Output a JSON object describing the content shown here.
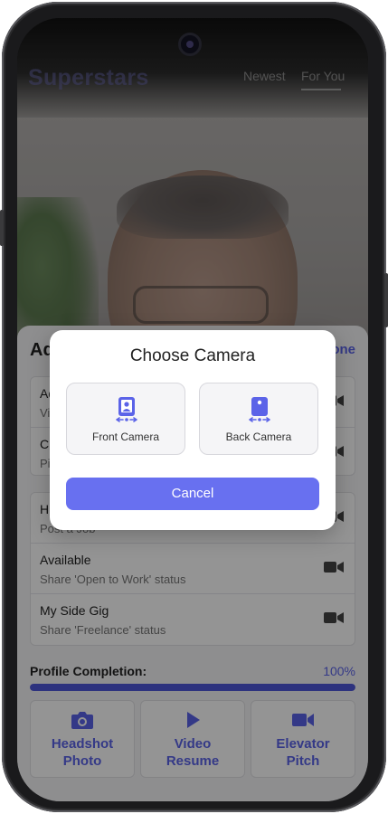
{
  "header": {
    "brand": "Superstars",
    "tabs": [
      {
        "label": "Newest",
        "active": false
      },
      {
        "label": "For You",
        "active": true
      }
    ]
  },
  "sheet": {
    "title": "Ad",
    "done_label": "one",
    "card1_rows": [
      {
        "title": "Ad",
        "subtitle": "Vi",
        "icon": "video-camera-icon"
      },
      {
        "title": "Cr",
        "subtitle": "Pi",
        "icon": "video-camera-icon"
      }
    ],
    "card2_rows": [
      {
        "title": "H",
        "subtitle": "Post a Job",
        "icon": "video-camera-icon"
      },
      {
        "title": "Available",
        "subtitle": "Share 'Open to Work' status",
        "icon": "video-camera-icon"
      },
      {
        "title": "My Side Gig",
        "subtitle": "Share 'Freelance' status",
        "icon": "video-camera-icon"
      }
    ],
    "profile_completion": {
      "label": "Profile Completion:",
      "value_text": "100%",
      "fraction": 1.0
    },
    "tiles": [
      {
        "label": "Headshot\nPhoto",
        "icon": "camera-icon"
      },
      {
        "label": "Video\nResume",
        "icon": "play-icon"
      },
      {
        "label": "Elevator\nPitch",
        "icon": "video-camera-icon"
      }
    ]
  },
  "dialog": {
    "title": "Choose Camera",
    "front_label": "Front Camera",
    "back_label": "Back Camera",
    "cancel_label": "Cancel"
  },
  "colors": {
    "accent": "#5b63e8",
    "button": "#6870f0",
    "progress": "#4f57d9"
  }
}
